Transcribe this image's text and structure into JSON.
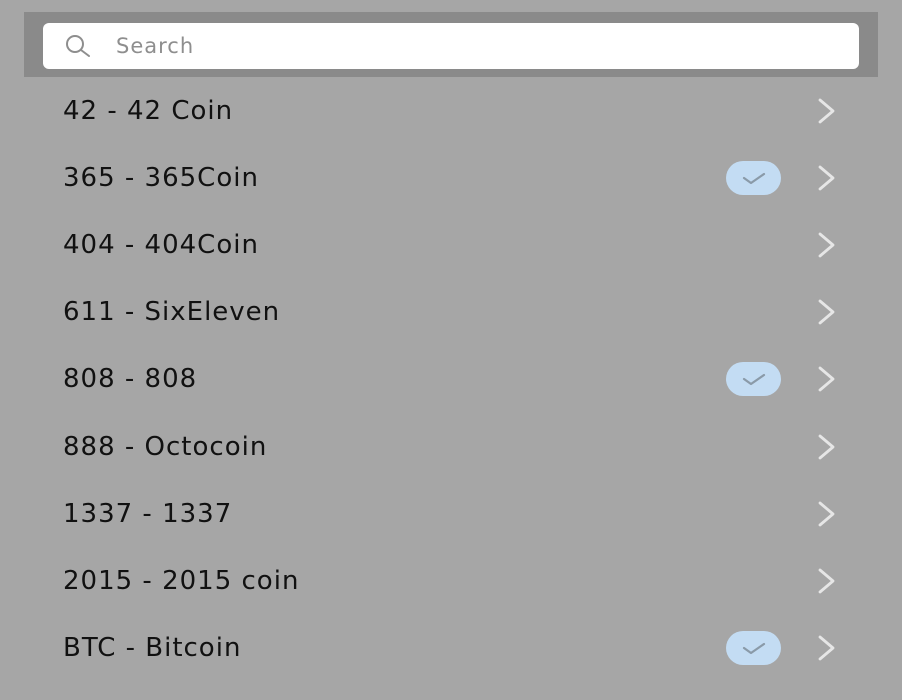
{
  "search": {
    "placeholder": "Search",
    "icon": "search-icon"
  },
  "colors": {
    "background": "#a6a6a6",
    "search_bar": "#8a8a8a",
    "check_badge": "#c3dcf3",
    "chevron": "#e6e6e6"
  },
  "coins": [
    {
      "label": "42 - 42 Coin",
      "selected": false
    },
    {
      "label": "365 - 365Coin",
      "selected": true
    },
    {
      "label": "404 - 404Coin",
      "selected": false
    },
    {
      "label": "611 - SixEleven",
      "selected": false
    },
    {
      "label": "808 - 808",
      "selected": true
    },
    {
      "label": "888 - Octocoin",
      "selected": false
    },
    {
      "label": "1337 - 1337",
      "selected": false
    },
    {
      "label": "2015 - 2015 coin",
      "selected": false
    },
    {
      "label": "BTC - Bitcoin",
      "selected": true
    }
  ]
}
